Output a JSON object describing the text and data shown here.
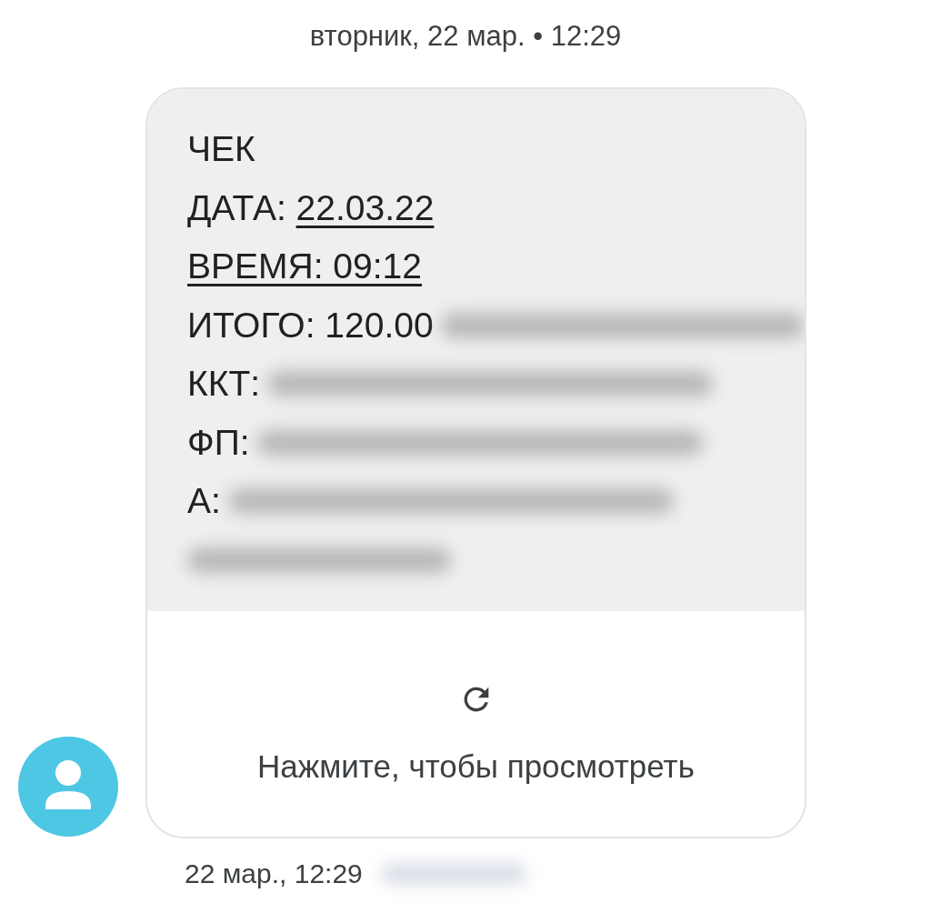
{
  "date_header": "вторник, 22 мар. • 12:29",
  "message": {
    "lines": [
      {
        "parts": [
          {
            "text": "ЧЕК",
            "link": false
          }
        ],
        "redacted": false
      },
      {
        "parts": [
          {
            "text": "ДАТА: ",
            "link": false
          },
          {
            "text": "22.03.22",
            "link": true
          }
        ],
        "redacted": false
      },
      {
        "parts": [
          {
            "text": "ВРЕМЯ: 09:12",
            "link": true
          }
        ],
        "redacted": false
      },
      {
        "parts": [
          {
            "text": "ИТОГО: 120.00",
            "link": false
          }
        ],
        "redacted": true
      },
      {
        "parts": [
          {
            "text": "ККТ:",
            "link": false
          }
        ],
        "redacted": true
      },
      {
        "parts": [
          {
            "text": "ФП:",
            "link": false
          }
        ],
        "redacted": true
      },
      {
        "parts": [
          {
            "text": "А:",
            "link": false
          }
        ],
        "redacted": true
      },
      {
        "redacted": true
      }
    ],
    "preview": {
      "label": "Нажмите, чтобы просмотреть"
    }
  },
  "footer": {
    "time": "22 мар., 12:29",
    "sender_redacted": true
  }
}
